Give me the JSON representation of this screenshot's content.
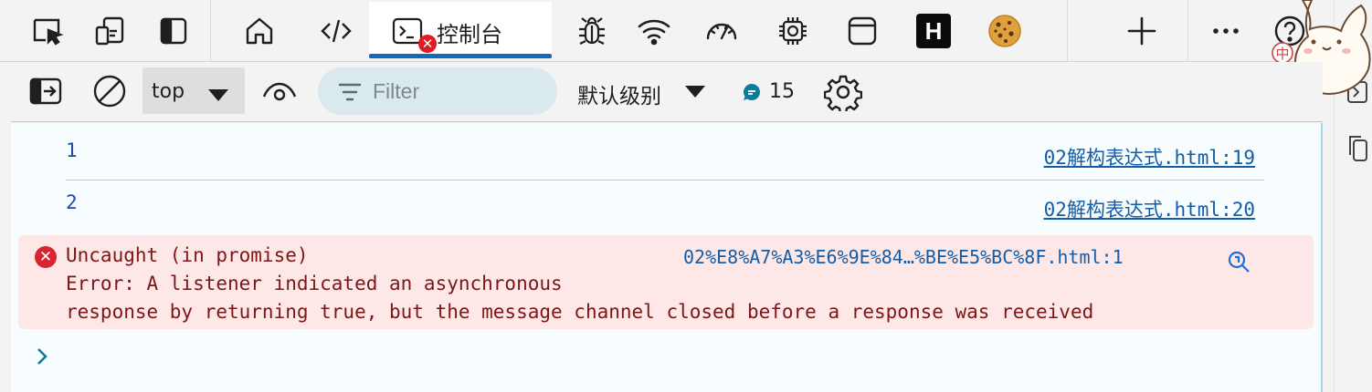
{
  "tabs": {
    "console_label": "控制台",
    "console_error_badge": "✕",
    "items": [
      {
        "name": "inspect-element-icon"
      },
      {
        "name": "device-emulation-icon"
      },
      {
        "name": "toggle-sidebar-icon"
      },
      {
        "name": "welcome-home-icon"
      },
      {
        "name": "elements-code-icon"
      },
      {
        "name": "console-icon",
        "active": true
      },
      {
        "name": "sources-bug-icon"
      },
      {
        "name": "network-wifi-icon"
      },
      {
        "name": "performance-gauge-icon"
      },
      {
        "name": "memory-chip-icon"
      },
      {
        "name": "application-window-icon"
      },
      {
        "name": "extension-h-badge",
        "label": "H"
      },
      {
        "name": "cookie-editor-icon"
      },
      {
        "name": "add-tab-icon"
      },
      {
        "name": "more-tools-icon"
      },
      {
        "name": "help-icon"
      }
    ],
    "h_badge_label": "H"
  },
  "toolbar": {
    "context_value": "top",
    "filter_placeholder": "Filter",
    "levels_label": "默认级别",
    "message_count": "15"
  },
  "console": {
    "rows": [
      {
        "value": "1",
        "source": "02解构表达式.html:19"
      },
      {
        "value": "2",
        "source": "02解构表达式.html:20"
      }
    ],
    "error": {
      "line1": "Uncaught (in promise)",
      "line2": "Error: A listener indicated an asynchronous",
      "line3": "response by returning true, but the message channel closed before a response was received",
      "source": "02%E8%A7%A3%E6%9E%84…%BE%E5%BC%8F.html:1"
    }
  },
  "sticker": {
    "character": "中"
  },
  "colors": {
    "accent": "#0f6cbd",
    "error_bg": "#fde7e7",
    "error_text": "#7d1616",
    "link": "#135da8",
    "value": "#1a4ba5",
    "console_bg": "#f7fdfe"
  }
}
